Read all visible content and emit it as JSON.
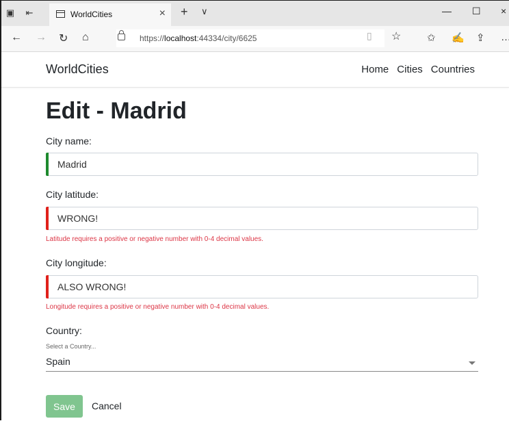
{
  "browser": {
    "tab_title": "WorldCities",
    "url_prefix": "https://",
    "url_host": "localhost",
    "url_rest": ":44334/city/6625"
  },
  "site": {
    "brand": "WorldCities",
    "nav": [
      "Home",
      "Cities",
      "Countries"
    ]
  },
  "form": {
    "heading": "Edit - Madrid",
    "name_label": "City name:",
    "name_value": "Madrid",
    "lat_label": "City latitude:",
    "lat_value": "WRONG!",
    "lat_error": "Latitude requires a positive or negative number with 0-4 decimal values.",
    "lon_label": "City longitude:",
    "lon_value": "ALSO WRONG!",
    "lon_error": "Longitude requires a positive or negative number with 0-4 decimal values.",
    "country_label": "Country:",
    "country_hint": "Select a Country...",
    "country_value": "Spain",
    "save_label": "Save",
    "cancel_label": "Cancel"
  },
  "colors": {
    "valid": "#1e8a2e",
    "invalid": "#e0211b",
    "error_text": "#dc3545",
    "save_bg": "#80c58f"
  }
}
